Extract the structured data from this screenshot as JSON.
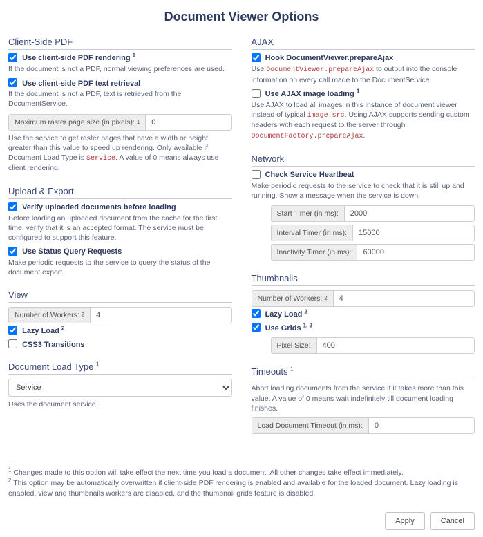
{
  "title": "Document Viewer Options",
  "left": {
    "clientPdf": {
      "heading": "Client-Side PDF",
      "useRendering": {
        "label": "Use client-side PDF rendering",
        "sup": "1",
        "checked": true,
        "desc": "If the document is not a PDF, normal viewing preferences are used."
      },
      "useText": {
        "label": "Use client-side PDF text retrieval",
        "checked": true,
        "desc": "If the document is not a PDF, text is retrieved from the DocumentService."
      },
      "maxRaster": {
        "label": "Maximum raster page size (in pixels):",
        "sup": "1",
        "value": "0"
      },
      "rasterDesc": {
        "pre": "Use the service to get raster pages that have a width or height greater than this value to speed up rendering. Only available if Document Load Type is ",
        "code": "Service",
        "post": ". A value of 0 means always use client rendering."
      }
    },
    "uploadExport": {
      "heading": "Upload & Export",
      "verify": {
        "label": "Verify uploaded documents before loading",
        "checked": true,
        "desc": "Before loading an uploaded document from the cache for the first time, verify that it is an accepted format. The service must be configured to support this feature."
      },
      "status": {
        "label": "Use Status Query Requests",
        "checked": true,
        "desc": "Make periodic requests to the service to query the status of the document export."
      }
    },
    "view": {
      "heading": "View",
      "workers": {
        "label": "Number of Workers:",
        "sup": "2",
        "value": "4"
      },
      "lazy": {
        "label": "Lazy Load",
        "sup": "2",
        "checked": true
      },
      "css3": {
        "label": "CSS3 Transitions",
        "checked": false
      }
    },
    "docLoad": {
      "heading": "Document Load Type",
      "sup": "1",
      "value": "Service",
      "desc": "Uses the document service."
    }
  },
  "right": {
    "ajax": {
      "heading": "AJAX",
      "hook": {
        "label": "Hook DocumentViewer.prepareAjax",
        "checked": true,
        "desc_pre": "Use ",
        "code1": "DocumentViewer.prepareAjax",
        "desc_post": " to output into the console information on every call made to the DocumentService."
      },
      "imageLoading": {
        "label": "Use AJAX image loading",
        "sup": "1",
        "checked": false,
        "desc_pre": "Use AJAX to load all images in this instance of document viewer instead of typical ",
        "code1": "image.src",
        "desc_mid": ". Using AJAX supports sending custom headers with each request to the server through ",
        "code2": "DocumentFactory.prepareAjax",
        "desc_post": "."
      }
    },
    "network": {
      "heading": "Network",
      "heartbeat": {
        "label": "Check Service Heartbeat",
        "checked": false,
        "desc": "Make periodic requests to the service to check that it is still up and running. Show a message when the service is down."
      },
      "start": {
        "label": "Start Timer (in ms):",
        "value": "2000"
      },
      "interval": {
        "label": "Interval Timer (in ms):",
        "value": "15000"
      },
      "inactivity": {
        "label": "Inactivity Timer (in ms):",
        "value": "60000"
      }
    },
    "thumbnails": {
      "heading": "Thumbnails",
      "workers": {
        "label": "Number of Workers:",
        "sup": "2",
        "value": "4"
      },
      "lazy": {
        "label": "Lazy Load",
        "sup": "2",
        "checked": true
      },
      "grids": {
        "label": "Use Grids",
        "sup": "1, 2",
        "checked": true
      },
      "pixel": {
        "label": "Pixel Size:",
        "value": "400"
      }
    },
    "timeouts": {
      "heading": "Timeouts",
      "sup": "1",
      "desc": "Abort loading documents from the service if it takes more than this value. A value of 0 means wait indefinitely till document loading finishes.",
      "loadDoc": {
        "label": "Load Document Timeout (in ms):",
        "value": "0"
      }
    }
  },
  "footnotes": {
    "n1": {
      "sup": "1",
      "text": "Changes made to this option will take effect the next time you load a document. All other changes take effect immediately."
    },
    "n2": {
      "sup": "2",
      "text": "This option may be automatically overwritten if client-side PDF rendering is enabled and available for the loaded document. Lazy loading is enabled, view and thumbnails workers are disabled, and the thumbnail grids feature is disabled."
    }
  },
  "buttons": {
    "apply": "Apply",
    "cancel": "Cancel"
  }
}
